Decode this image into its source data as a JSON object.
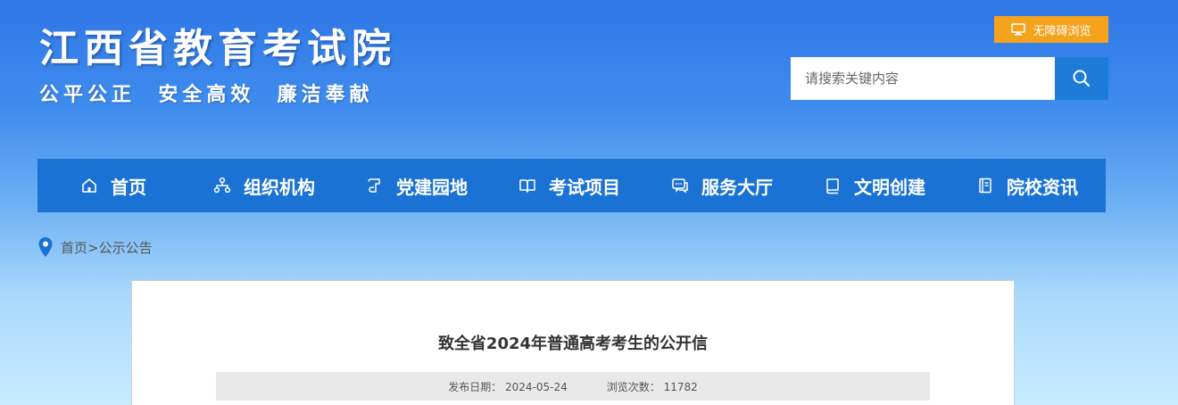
{
  "header": {
    "site_title": "江西省教育考试院",
    "slogan": "公平公正  安全高效  廉洁奉献",
    "accessibility_label": "无障碍浏览",
    "search_placeholder": "请搜索关键内容"
  },
  "nav": {
    "items": [
      {
        "label": "首页",
        "icon": "home-icon"
      },
      {
        "label": "组织机构",
        "icon": "org-chart-icon"
      },
      {
        "label": "党建园地",
        "icon": "scroll-icon"
      },
      {
        "label": "考试项目",
        "icon": "book-open-icon"
      },
      {
        "label": "服务大厅",
        "icon": "chat-icon"
      },
      {
        "label": "文明创建",
        "icon": "book-icon"
      },
      {
        "label": "院校资讯",
        "icon": "document-icon"
      }
    ]
  },
  "breadcrumb": {
    "home": "首页",
    "separator": ">",
    "current": "公示公告"
  },
  "article": {
    "title": "致全省2024年普通高考考生的公开信",
    "date_label": "发布日期：",
    "date_value": "2024-05-24",
    "views_label": "浏览次数：",
    "views_value": "11782"
  },
  "colors": {
    "nav_bg": "#1a72d4",
    "accent_orange": "#f5a21c",
    "search_button": "#1e7bd8",
    "location_pin": "#1a72d4"
  }
}
